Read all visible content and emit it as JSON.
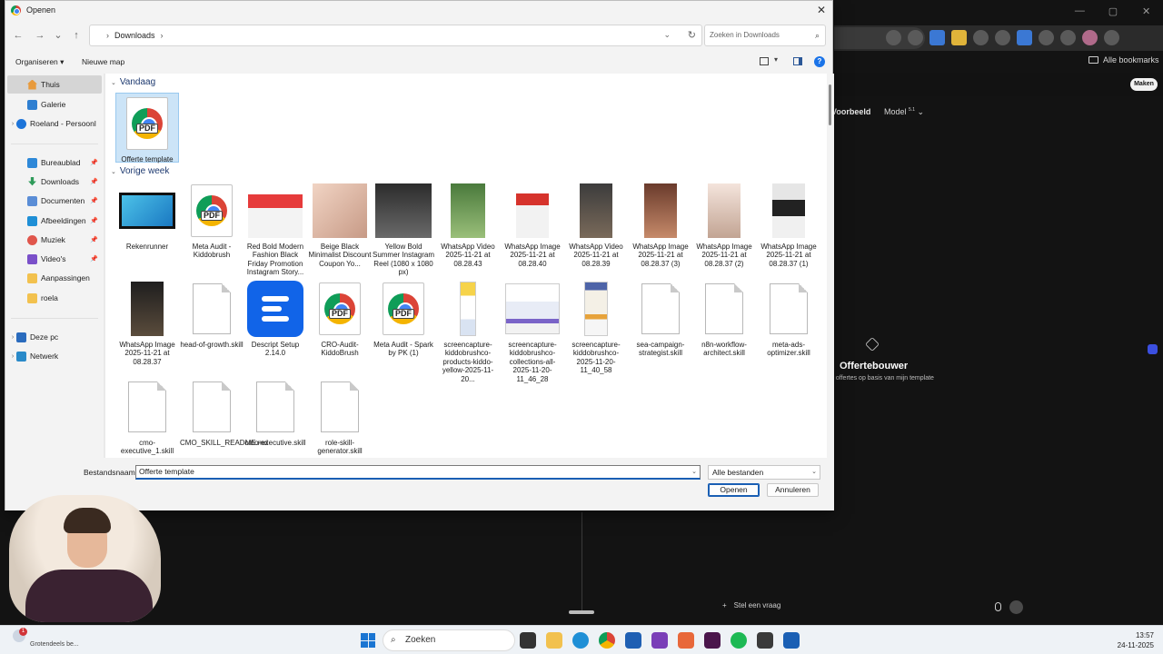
{
  "browser": {
    "bookmarks_label": "Alle bookmarks",
    "maken_button": "Maken",
    "voorbeeld_label": "Voorbeeld",
    "model_label": "Model",
    "model_version": "5.1",
    "builder_title": "Offertebouwer",
    "builder_subtitle": "t offertes op basis van mijn template",
    "ask_placeholder": "Stel een vraag",
    "ask_plus": "+"
  },
  "dialog": {
    "title": "Openen",
    "close_label": "✕",
    "breadcrumb": [
      "Downloads"
    ],
    "search_placeholder": "Zoeken in Downloads",
    "organize_label": "Organiseren ▾",
    "new_folder_label": "Nieuwe map",
    "help_label": "?",
    "sidebar": {
      "items": [
        {
          "label": "Thuis",
          "icon": "home-icon"
        },
        {
          "label": "Galerie",
          "icon": "gallery-icon"
        },
        {
          "label": "Roeland - Persoonl",
          "icon": "cloud-icon"
        },
        {
          "label": "Bureaublad",
          "icon": "desktop-icon"
        },
        {
          "label": "Downloads",
          "icon": "download-icon"
        },
        {
          "label": "Documenten",
          "icon": "documents-icon"
        },
        {
          "label": "Afbeeldingen",
          "icon": "pictures-icon"
        },
        {
          "label": "Muziek",
          "icon": "music-icon"
        },
        {
          "label": "Video's",
          "icon": "videos-icon"
        },
        {
          "label": "Aanpassingen",
          "icon": "folder-icon"
        },
        {
          "label": "roela",
          "icon": "folder-icon"
        },
        {
          "label": "Deze pc",
          "icon": "pc-icon"
        },
        {
          "label": "Netwerk",
          "icon": "network-icon"
        }
      ]
    },
    "groups": {
      "today": "Vandaag",
      "last_week": "Vorige week"
    },
    "files_today": [
      {
        "name": "Offerte template",
        "type": "pdf"
      }
    ],
    "files_last_week": [
      {
        "name": "Rekenrunner",
        "type": "video"
      },
      {
        "name": "Meta Audit - Kiddobrush",
        "type": "pdf"
      },
      {
        "name": "Red Bold Modern Fashion Black Friday Promotion Instagram Story...",
        "type": "image"
      },
      {
        "name": "Beige Black Minimalist Discount Coupon Yo...",
        "type": "image"
      },
      {
        "name": "Yellow Bold Summer Instagram Reel (1080 x 1080 px)",
        "type": "image"
      },
      {
        "name": "WhatsApp Video 2025-11-21 at 08.28.43",
        "type": "image"
      },
      {
        "name": "WhatsApp Image 2025-11-21 at 08.28.40",
        "type": "image"
      },
      {
        "name": "WhatsApp Video 2025-11-21 at 08.28.39",
        "type": "image"
      },
      {
        "name": "WhatsApp Image 2025-11-21 at 08.28.37 (3)",
        "type": "image"
      },
      {
        "name": "WhatsApp Image 2025-11-21 at 08.28.37 (2)",
        "type": "image"
      },
      {
        "name": "WhatsApp Image 2025-11-21 at 08.28.37 (1)",
        "type": "image"
      },
      {
        "name": "WhatsApp Image 2025-11-21 at 08.28.37",
        "type": "image"
      },
      {
        "name": "head-of-growth.skill",
        "type": "blank"
      },
      {
        "name": "Descript Setup 2.14.0",
        "type": "app"
      },
      {
        "name": "CRO-Audit-KiddoBrush",
        "type": "pdf"
      },
      {
        "name": "Meta Audit - Spark by PK (1)",
        "type": "pdf"
      },
      {
        "name": "screencapture-kiddobrushco-products-kiddo-yellow-2025-11-20...",
        "type": "image"
      },
      {
        "name": "screencapture-kiddobrushco-collections-all-2025-11-20-11_46_28",
        "type": "image"
      },
      {
        "name": "screencapture-kiddobrushco-2025-11-20-11_40_58",
        "type": "image"
      },
      {
        "name": "sea-campaign-strategist.skill",
        "type": "blank"
      },
      {
        "name": "n8n-workflow-architect.skill",
        "type": "blank"
      },
      {
        "name": "meta-ads-optimizer.skill",
        "type": "blank"
      },
      {
        "name": "cmo-executive_1.skill",
        "type": "blank"
      },
      {
        "name": "CMO_SKILL_README.md",
        "type": "blank"
      },
      {
        "name": "cmo-executive.skill",
        "type": "blank"
      },
      {
        "name": "role-skill-generator.skill",
        "type": "blank"
      }
    ],
    "filename_label": "Bestandsnaam:",
    "filename_value": "Offerte template",
    "filetype_value": "Alle bestanden",
    "open_button": "Openen",
    "cancel_button": "Annuleren"
  },
  "taskbar": {
    "weather_badge": "1",
    "weather_text": "Grotendeels be...",
    "search_label": "Zoeken",
    "time": "13:57",
    "date": "24-11-2025"
  }
}
